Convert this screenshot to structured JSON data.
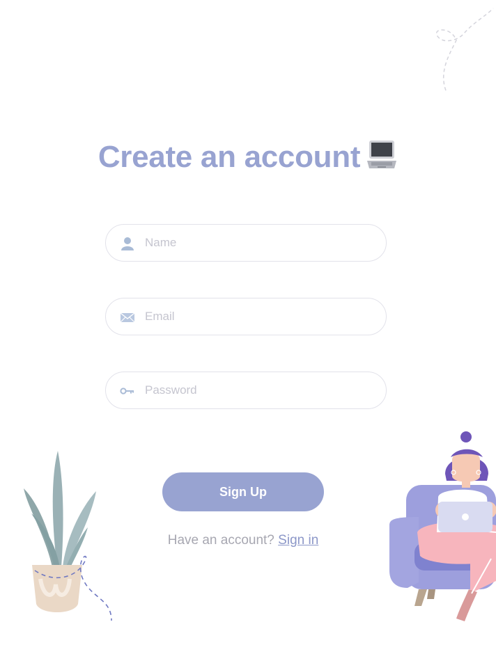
{
  "form": {
    "title": "Create an account",
    "title_icon": "laptop-icon",
    "fields": [
      {
        "icon": "user-icon",
        "placeholder": "Name",
        "value": ""
      },
      {
        "icon": "envelope-icon",
        "placeholder": "Email",
        "value": ""
      },
      {
        "icon": "key-icon",
        "placeholder": "Password",
        "value": ""
      }
    ],
    "submit_label": "Sign Up",
    "account_prompt": "Have an account?",
    "sign_in_label": "Sign in"
  },
  "colors": {
    "accent": "#98a3d1",
    "field_border": "#e2e2ea",
    "placeholder": "#c5c5cf",
    "muted_text": "#a7a7b1",
    "link": "#8c97c8"
  },
  "illustrations": [
    "plant-pot-illustration",
    "woman-on-sofa-illustration",
    "dashed-swirl-decoration"
  ]
}
